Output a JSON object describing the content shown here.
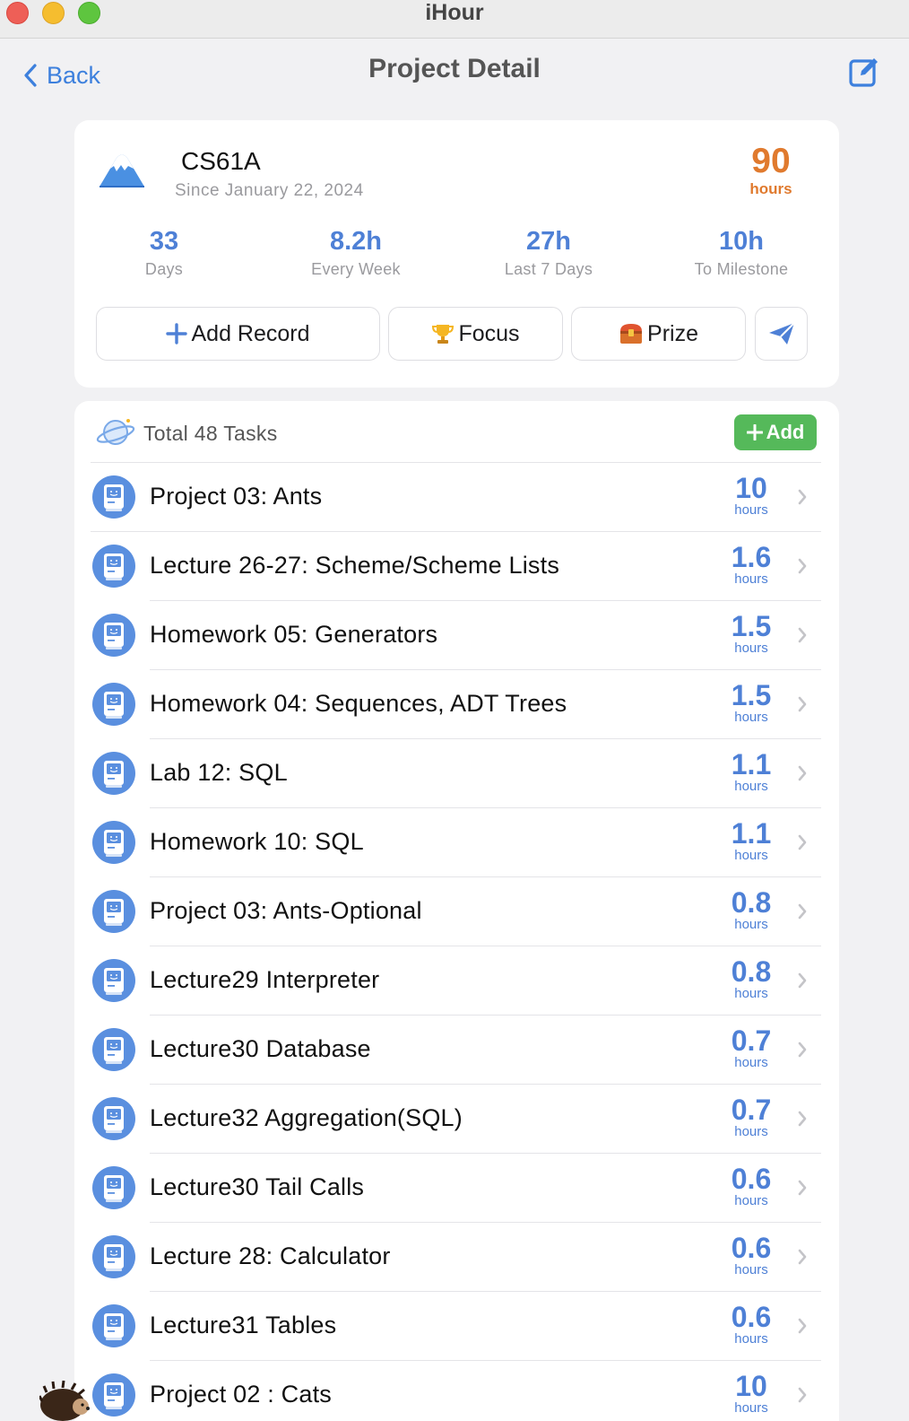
{
  "window": {
    "title": "iHour"
  },
  "nav": {
    "back_label": "Back",
    "title": "Project Detail"
  },
  "project": {
    "name": "CS61A",
    "since": "Since January 22, 2024",
    "total_hours": "90",
    "total_hours_unit": "hours",
    "stats": [
      {
        "value": "33",
        "label": "Days"
      },
      {
        "value": "8.2h",
        "label": "Every Week"
      },
      {
        "value": "27h",
        "label": "Last 7 Days"
      },
      {
        "value": "10h",
        "label": "To Milestone"
      }
    ],
    "actions": {
      "add_record": "Add Record",
      "focus": "Focus",
      "prize": "Prize"
    }
  },
  "tasks": {
    "total_label": "Total 48 Tasks",
    "add_label": "Add",
    "unit": "hours",
    "items": [
      {
        "name": "Project 03: Ants",
        "hours": "10"
      },
      {
        "name": "Lecture 26-27: Scheme/Scheme Lists",
        "hours": "1.6"
      },
      {
        "name": "Homework 05: Generators",
        "hours": "1.5"
      },
      {
        "name": "Homework 04: Sequences, ADT Trees",
        "hours": "1.5"
      },
      {
        "name": "Lab 12: SQL",
        "hours": "1.1"
      },
      {
        "name": "Homework 10: SQL",
        "hours": "1.1"
      },
      {
        "name": "Project 03: Ants-Optional",
        "hours": "0.8"
      },
      {
        "name": "Lecture29 Interpreter",
        "hours": "0.8"
      },
      {
        "name": "Lecture30 Database",
        "hours": "0.7"
      },
      {
        "name": "Lecture32 Aggregation(SQL)",
        "hours": "0.7"
      },
      {
        "name": "Lecture30 Tail Calls",
        "hours": "0.6"
      },
      {
        "name": "Lecture 28: Calculator",
        "hours": "0.6"
      },
      {
        "name": "Lecture31 Tables",
        "hours": "0.6"
      },
      {
        "name": "Project 02 : Cats",
        "hours": "10"
      }
    ]
  },
  "colors": {
    "accent_blue": "#4e80d6",
    "hours_orange": "#e07a2e",
    "add_green": "#55b95a",
    "back_blue": "#3d80dd"
  }
}
